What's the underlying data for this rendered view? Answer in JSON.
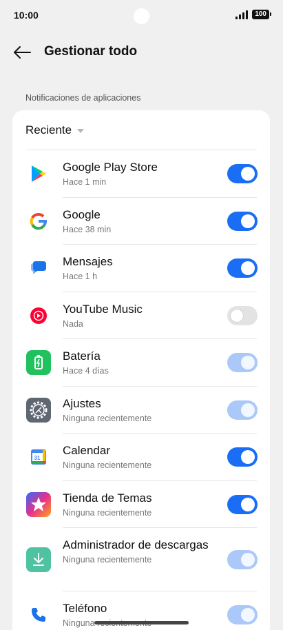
{
  "status_bar": {
    "time": "10:00",
    "battery": "100"
  },
  "header": {
    "title": "Gestionar todo"
  },
  "section_label": "Notificaciones de aplicaciones",
  "filter": {
    "label": "Reciente"
  },
  "apps": [
    {
      "name": "Google Play Store",
      "sub": "Hace 1 min",
      "icon": "play-store-icon",
      "toggle": "on"
    },
    {
      "name": "Google",
      "sub": "Hace 38 min",
      "icon": "google-icon",
      "toggle": "on"
    },
    {
      "name": "Mensajes",
      "sub": "Hace 1 h",
      "icon": "messages-icon",
      "toggle": "on"
    },
    {
      "name": "YouTube Music",
      "sub": "Nada",
      "icon": "youtube-music-icon",
      "toggle": "off"
    },
    {
      "name": "Batería",
      "sub": "Hace 4 días",
      "icon": "battery-icon",
      "toggle": "disabled"
    },
    {
      "name": "Ajustes",
      "sub": "Ninguna recientemente",
      "icon": "settings-gear-icon",
      "toggle": "disabled"
    },
    {
      "name": "Calendar",
      "sub": "Ninguna recientemente",
      "icon": "calendar-icon",
      "toggle": "on"
    },
    {
      "name": "Tienda de Temas",
      "sub": "Ninguna recientemente",
      "icon": "theme-store-icon",
      "toggle": "on"
    },
    {
      "name": "Administrador de descargas",
      "sub": "Ninguna recientemente",
      "icon": "download-icon",
      "toggle": "disabled"
    },
    {
      "name": "Teléfono",
      "sub": "Ninguna recientemente",
      "icon": "phone-icon",
      "toggle": "disabled"
    }
  ],
  "colors": {
    "accent": "#1a6ef5",
    "toggle_disabled": "#aac8f8",
    "toggle_off": "#e3e3e3"
  }
}
